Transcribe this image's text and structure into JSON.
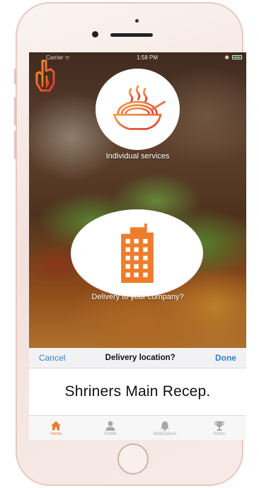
{
  "status_bar": {
    "carrier": "Carrier ᯤ",
    "time": "1:58 PM"
  },
  "options": [
    {
      "label": "Individual services",
      "icon": "noodle-bowl-icon"
    },
    {
      "label": "Delivery to your company?",
      "icon": "office-building-icon"
    }
  ],
  "picker": {
    "cancel": "Cancel",
    "title": "Delivery location?",
    "done": "Done",
    "selected_value": "Shriners Main Recep."
  },
  "tabs": [
    {
      "label": "Home",
      "icon": "home-icon",
      "active": true
    },
    {
      "label": "Profile",
      "icon": "profile-icon",
      "active": false
    },
    {
      "label": "Notifications",
      "icon": "bell-icon",
      "active": false
    },
    {
      "label": "Points",
      "icon": "trophy-icon",
      "active": false
    }
  ],
  "colors": {
    "accent": "#ee7d2b",
    "link_blue": "#2f7fd6",
    "icon_gray": "#a8a8a8"
  }
}
